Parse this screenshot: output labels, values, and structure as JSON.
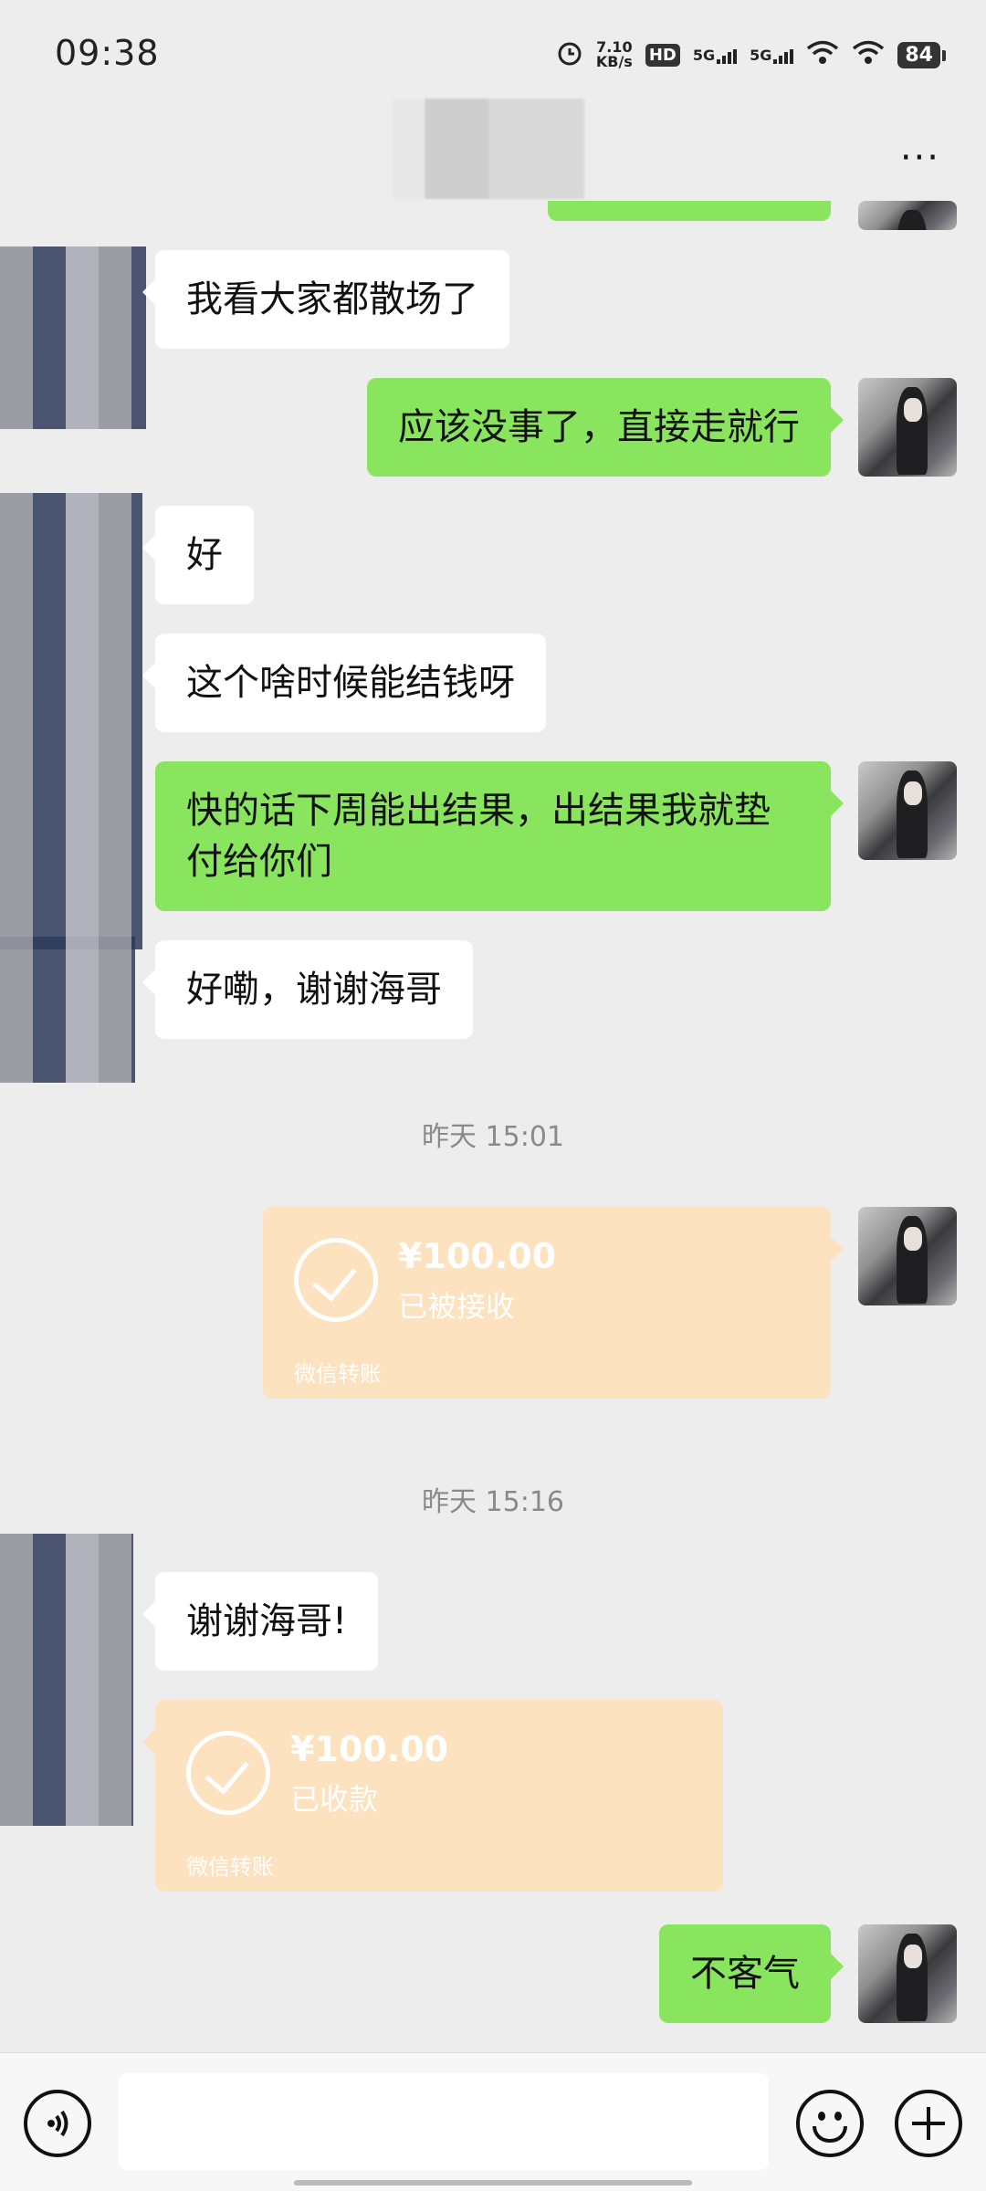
{
  "status_bar": {
    "time": "09:38",
    "speed_value": "7.10",
    "speed_unit": "KB/s",
    "hd_label": "HD",
    "sim1": "5G",
    "sim2": "5G",
    "battery": "84"
  },
  "header": {
    "more_label": "···"
  },
  "messages": [
    {
      "side": "left",
      "text": "我看大家都散场了"
    },
    {
      "side": "right",
      "text": "应该没事了，直接走就行"
    },
    {
      "side": "left",
      "text": "好"
    },
    {
      "side": "left",
      "text": "这个啥时候能结钱呀"
    },
    {
      "side": "right",
      "text": "快的话下周能出结果，出结果我就垫付给你们"
    },
    {
      "side": "left",
      "text": "好嘞，谢谢海哥"
    }
  ],
  "timestamp_1": "昨天 15:01",
  "transfer_1": {
    "amount": "¥100.00",
    "status": "已被接收",
    "footer": "微信转账"
  },
  "timestamp_2": "昨天 15:16",
  "messages_2": [
    {
      "side": "left",
      "text": "谢谢海哥!"
    }
  ],
  "transfer_2": {
    "amount": "¥100.00",
    "status": "已收款",
    "footer": "微信转账"
  },
  "messages_3": [
    {
      "side": "right",
      "text": "不客气"
    }
  ],
  "input_bar": {
    "placeholder": ""
  }
}
